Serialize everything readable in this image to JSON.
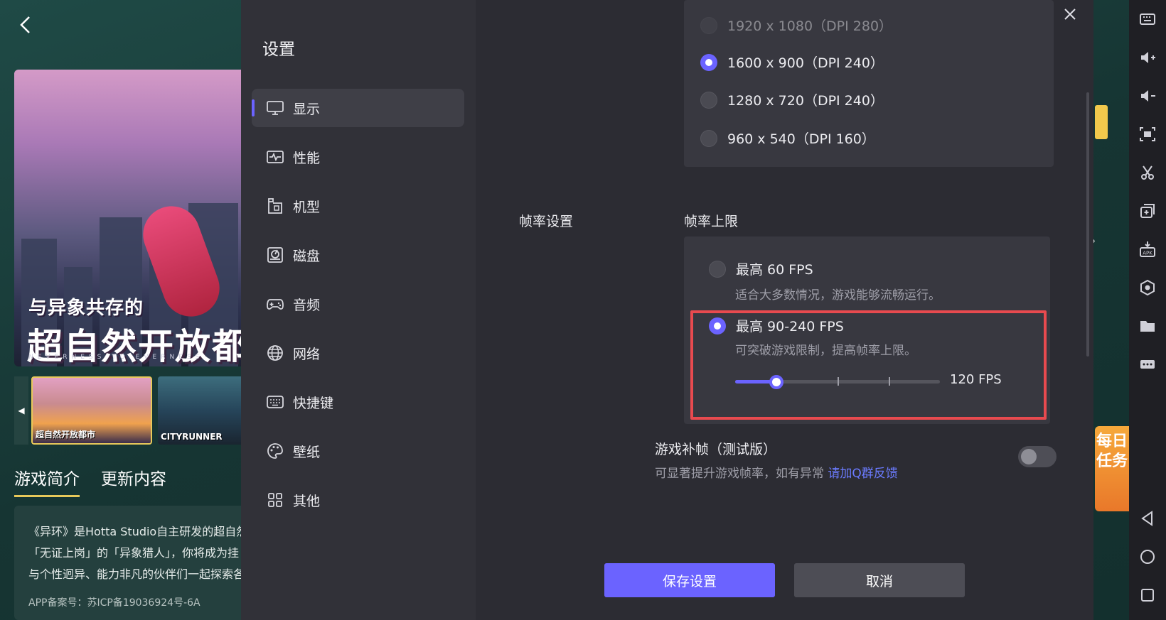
{
  "background_app": {
    "hero_subtitle": "与异象共存的",
    "hero_title": "超自然开放都",
    "hero_tagline": "NEVERNESS TO EVERNESS",
    "thumbnails": [
      {
        "caption": "超自然开放都市"
      },
      {
        "caption": "CITYRUNNER"
      }
    ],
    "tabs": [
      {
        "label": "游戏简介",
        "active": true
      },
      {
        "label": "更新内容",
        "active": false
      }
    ],
    "intro_lines": [
      "《异环》是Hotta Studio自主研发的超自然都",
      "「无证上岗」的「异象猎人」，你将成为挂",
      "与个性迥异、能力非凡的伙伴们一起探索各"
    ],
    "icp": "APP备案号：苏ICP备19036924号-6A",
    "daily_task": "每日任务",
    "more_hint": "〉"
  },
  "toolbar": {
    "icons": [
      "keyboard-icon",
      "volume-up-icon",
      "volume-down-icon",
      "screenshot-icon",
      "scissors-icon",
      "multi-instance-icon",
      "apk-install-icon",
      "settings-hex-icon",
      "folder-icon",
      "more-icon",
      "back-triangle-icon",
      "home-circle-icon",
      "recent-square-icon"
    ]
  },
  "settings": {
    "title": "设置",
    "nav": [
      {
        "id": "display",
        "label": "显示",
        "icon": "monitor-icon",
        "active": true
      },
      {
        "id": "performance",
        "label": "性能",
        "icon": "pulse-icon",
        "active": false
      },
      {
        "id": "model",
        "label": "机型",
        "icon": "device-icon",
        "active": false
      },
      {
        "id": "disk",
        "label": "磁盘",
        "icon": "disk-icon",
        "active": false
      },
      {
        "id": "audio",
        "label": "音频",
        "icon": "gamepad-icon",
        "active": false
      },
      {
        "id": "network",
        "label": "网络",
        "icon": "globe-icon",
        "active": false
      },
      {
        "id": "shortcuts",
        "label": "快捷键",
        "icon": "keyboard-icon",
        "active": false
      },
      {
        "id": "wallpaper",
        "label": "壁纸",
        "icon": "palette-icon",
        "active": false
      },
      {
        "id": "other",
        "label": "其他",
        "icon": "grid-icon",
        "active": false
      }
    ],
    "resolutions": [
      {
        "label": "1920 x 1080（DPI 280）",
        "selected": false
      },
      {
        "label": "1600 x 900（DPI 240）",
        "selected": true
      },
      {
        "label": "1280 x 720（DPI 240）",
        "selected": false
      },
      {
        "label": "960 x 540（DPI 160）",
        "selected": false
      }
    ],
    "framerate": {
      "section_label": "帧率设置",
      "limit_label": "帧率上限",
      "options": [
        {
          "label": "最高 60 FPS",
          "desc": "适合大多数情况，游戏能够流畅运行。",
          "selected": false
        },
        {
          "label": "最高 90-240 FPS",
          "desc": "可突破游戏限制，提高帧率上限。",
          "selected": true
        }
      ],
      "slider_value": "120 FPS",
      "slider_fraction": 0.2
    },
    "frame_interp": {
      "label": "游戏补帧（测试版）",
      "desc": "可显著提升游戏帧率，如有异常",
      "link": "请加Q群反馈",
      "enabled": false
    },
    "save_label": "保存设置",
    "cancel_label": "取消"
  }
}
